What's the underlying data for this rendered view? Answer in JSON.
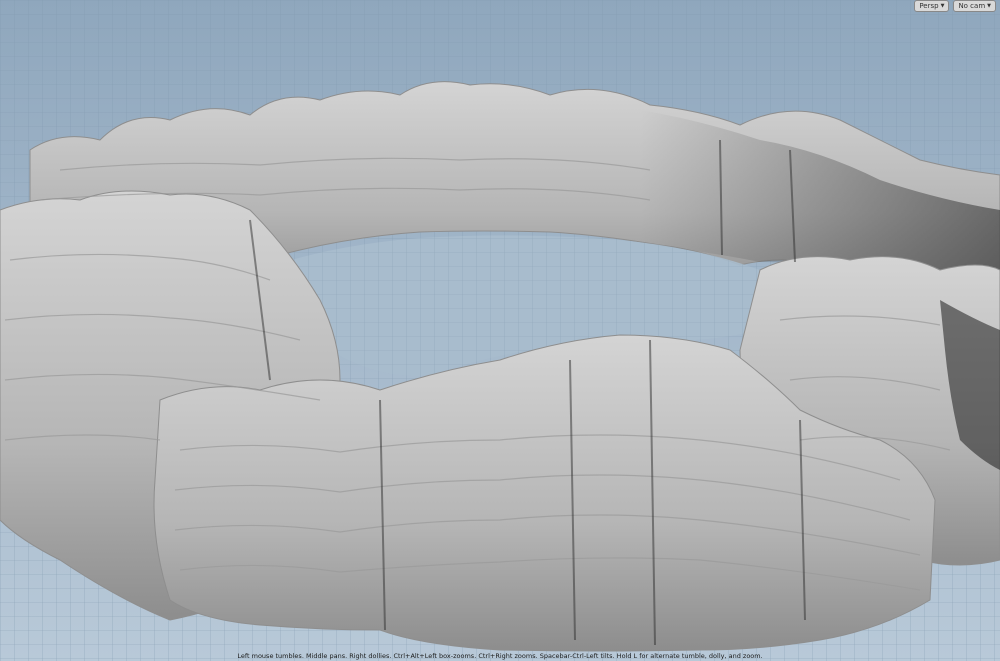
{
  "viewport": {
    "camera_view_label": "Persp",
    "camera_label": "No cam",
    "status_hint": "Left mouse tumbles. Middle pans. Right dollies. Ctrl+Alt+Left box-zooms. Ctrl+Right zooms. Spacebar-Ctrl-Left tilts. Hold L for alternate tumble, dolly, and zoom.",
    "corner_readout": "",
    "colors": {
      "ground_far": "#8fa7bd",
      "ground_near": "#b8c9d8",
      "grid": "#7f97ad",
      "rock_light": "#cfcfcf",
      "rock_mid": "#a9a9a9",
      "rock_dark": "#3c3c3c"
    }
  }
}
